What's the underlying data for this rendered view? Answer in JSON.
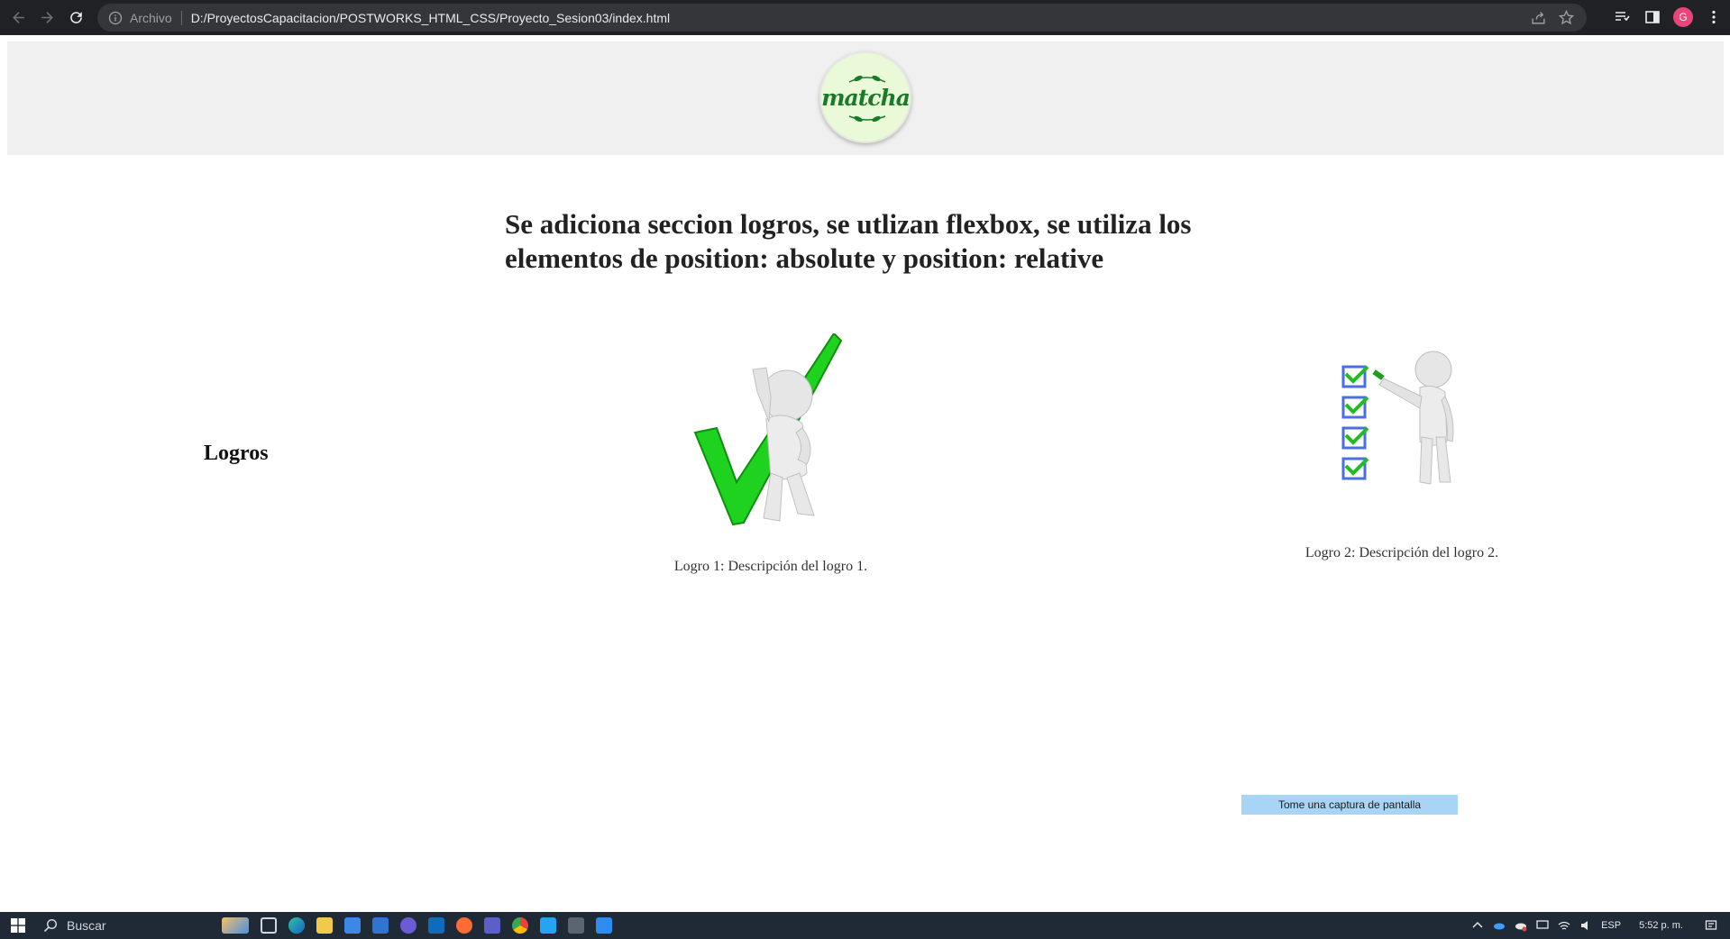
{
  "browser": {
    "scheme_label": "Archivo",
    "url": "D:/ProyectosCapacitacion/POSTWORKS_HTML_CSS/Proyecto_Sesion03/index.html",
    "profile_initial": "G"
  },
  "header": {
    "logo_text": "matcha"
  },
  "main": {
    "headline": "Se adiciona seccion logros, se utlizan flexbox, se utiliza los elementos de position: absolute y position: relative",
    "section_title": "Logros",
    "achievements": [
      {
        "caption": "Logro 1: Descripción del logro 1."
      },
      {
        "caption": "Logro 2: Descripción del logro 2."
      }
    ]
  },
  "overlay": {
    "capture_tip": "Tome una captura de pantalla"
  },
  "taskbar": {
    "search_placeholder": "Buscar",
    "language": "ESP",
    "time": "5:52 p. m."
  },
  "colors": {
    "chrome_bg": "#202124",
    "header_bg": "#f0f0f0",
    "logo_green": "#1b7a2a",
    "check_green": "#22cc22",
    "taskbar_bg": "#1f2a36"
  }
}
